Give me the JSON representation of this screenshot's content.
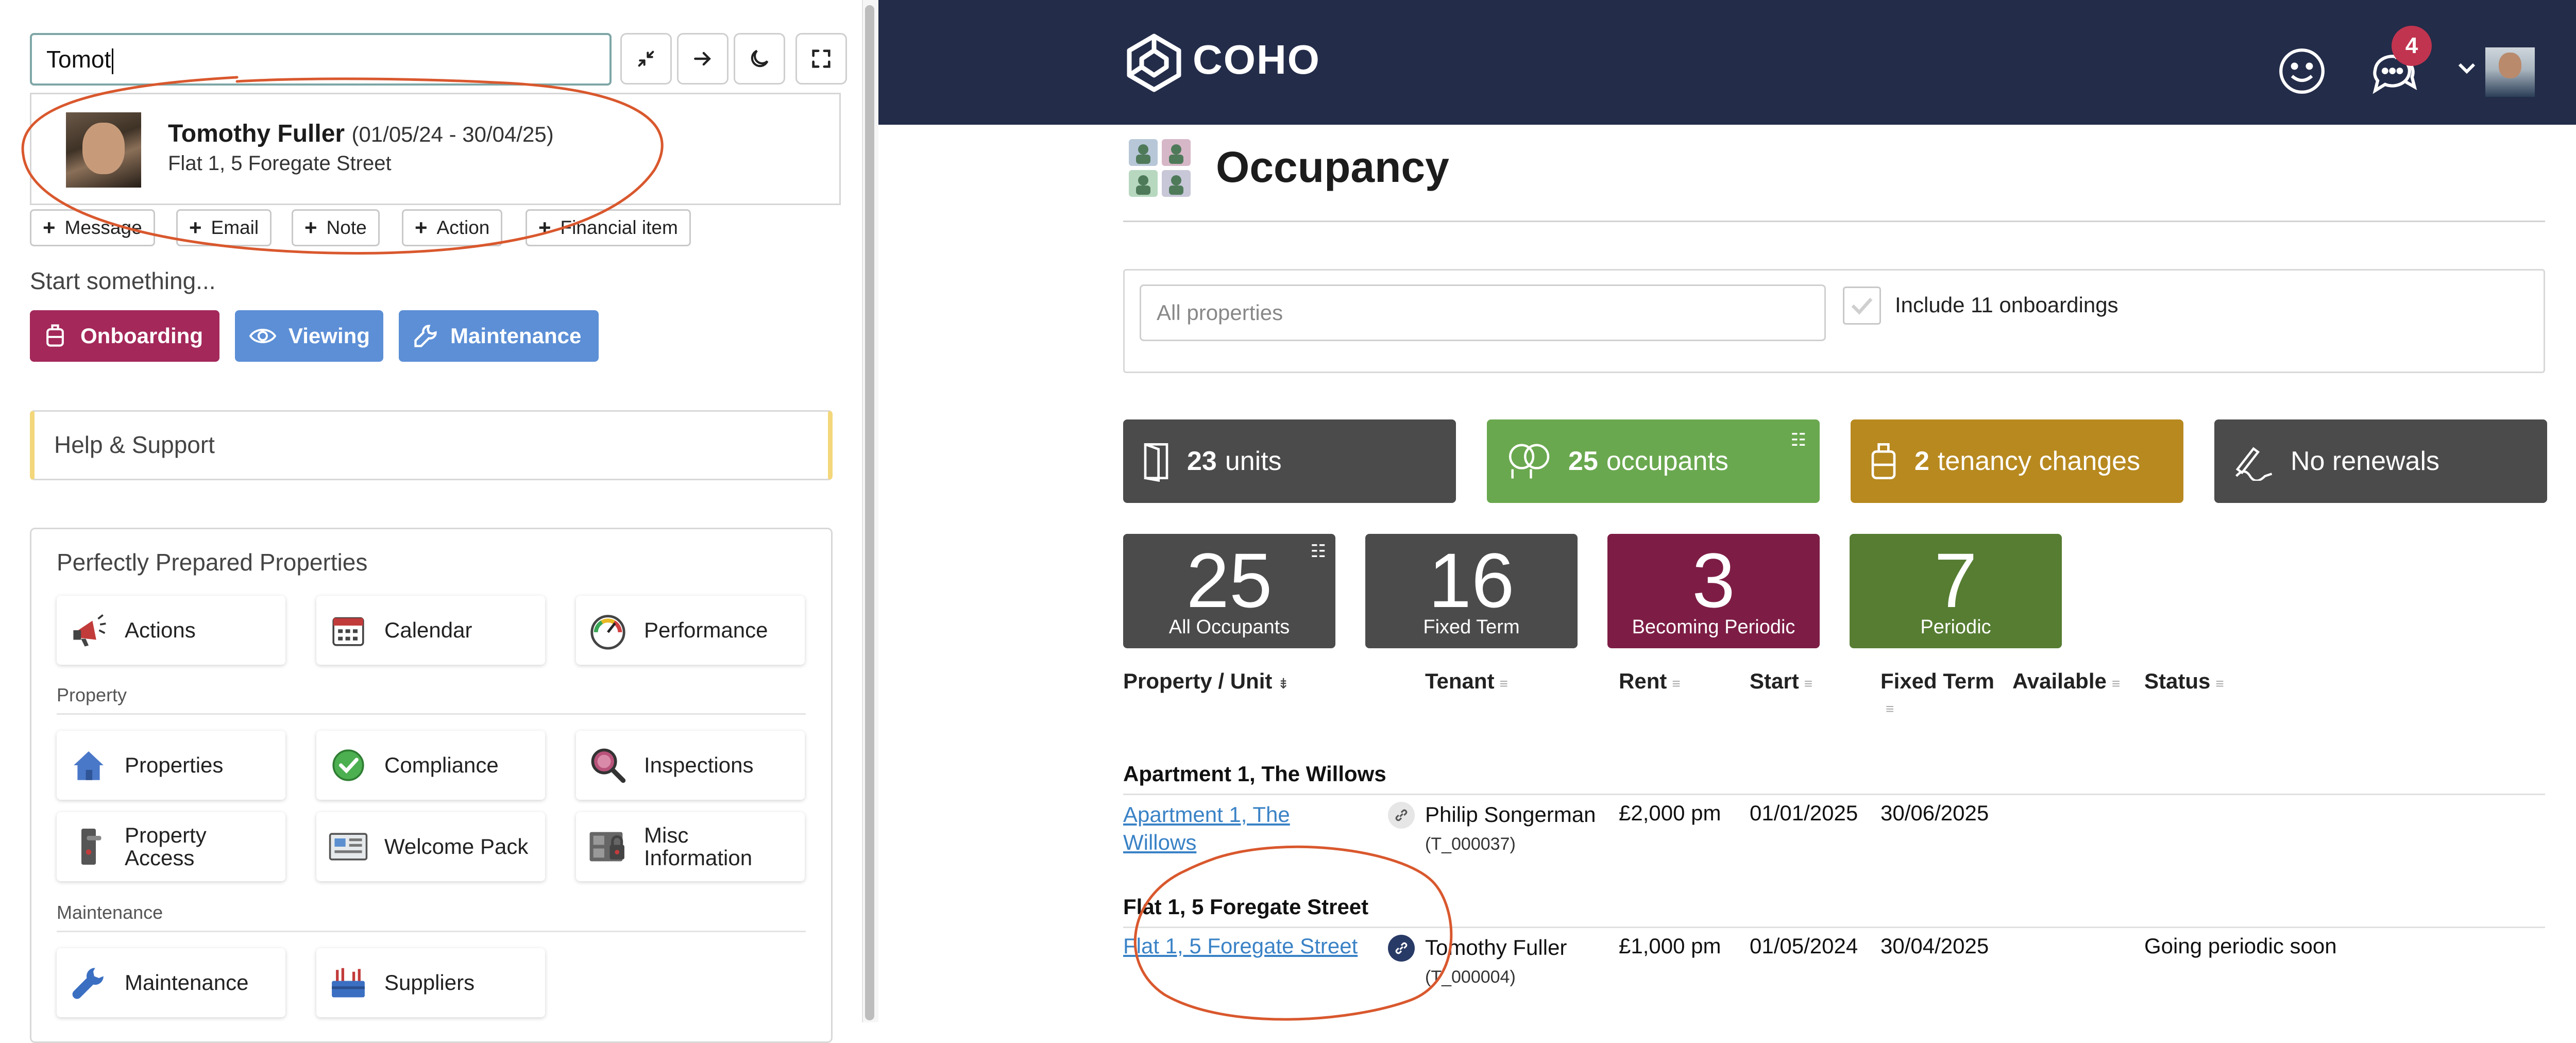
{
  "search": {
    "value": "Tomot"
  },
  "toolbar": {
    "collapse_icon": "collapse-icon",
    "go_icon": "arrow-right-icon",
    "dark_icon": "moon-icon",
    "fullscreen_icon": "fullscreen-icon"
  },
  "result": {
    "name": "Tomothy Fuller",
    "dates": "(01/05/24 - 30/04/25)",
    "address": "Flat 1, 5 Foregate Street"
  },
  "quick_actions": [
    "Message",
    "Email",
    "Note",
    "Action",
    "Financial item"
  ],
  "start": {
    "label": "Start something...",
    "buttons": [
      {
        "label": "Onboarding",
        "color": "#a4285a"
      },
      {
        "label": "Viewing",
        "color": "#5c8fd6"
      },
      {
        "label": "Maintenance",
        "color": "#5c8fd6"
      }
    ]
  },
  "help": {
    "label": "Help & Support"
  },
  "ppp": {
    "title": "Perfectly Prepared Properties",
    "top_tiles": [
      "Actions",
      "Calendar",
      "Performance"
    ],
    "property_section": "Property",
    "property_tiles": [
      "Properties",
      "Compliance",
      "Inspections",
      "Property Access",
      "Welcome Pack",
      "Misc Information"
    ],
    "maintenance_section": "Maintenance",
    "maintenance_tiles": [
      "Maintenance",
      "Suppliers"
    ]
  },
  "header": {
    "logo": "COHO",
    "notification_count": "4"
  },
  "page": {
    "title": "Occupancy"
  },
  "filters": {
    "property_placeholder": "All properties",
    "include_label": "Include 11 onboardings"
  },
  "stats": [
    {
      "count": "23",
      "label": "units",
      "color": "#4b4b4b"
    },
    {
      "count": "25",
      "label": "occupants",
      "color": "#6aa84f"
    },
    {
      "count": "2",
      "label": "tenancy changes",
      "color": "#b7891f"
    },
    {
      "count": "",
      "label": "No renewals",
      "color": "#4b4b4b"
    }
  ],
  "summary": [
    {
      "value": "25",
      "label": "All Occupants",
      "color": "#4b4b4b"
    },
    {
      "value": "16",
      "label": "Fixed Term",
      "color": "#4b4b4b"
    },
    {
      "value": "3",
      "label": "Becoming Periodic",
      "color": "#7d1d45"
    },
    {
      "value": "7",
      "label": "Periodic",
      "color": "#567d32"
    }
  ],
  "table": {
    "columns": [
      "Property / Unit",
      "Tenant",
      "Rent",
      "Start",
      "Fixed Term",
      "Available",
      "Status"
    ],
    "groups": [
      {
        "name": "Apartment 1, The Willows",
        "row": {
          "unit": "Apartment 1, The Willows",
          "tenant": "Philip Songerman",
          "ref": "(T_000037)",
          "rent": "£2,000 pm",
          "start": "01/01/2025",
          "fixed_term": "30/06/2025",
          "available": "",
          "status": ""
        }
      },
      {
        "name": "Flat 1, 5 Foregate Street",
        "row": {
          "unit": "Flat 1, 5 Foregate Street",
          "tenant": "Tomothy Fuller",
          "ref": "(T_000004)",
          "rent": "£1,000 pm",
          "start": "01/05/2024",
          "fixed_term": "30/04/2025",
          "available": "",
          "status": "Going periodic soon"
        }
      }
    ]
  },
  "colors": {
    "topbar": "#232c49",
    "link": "#3a82c6",
    "annotation": "#d9582e",
    "badge": "#c1344f"
  }
}
